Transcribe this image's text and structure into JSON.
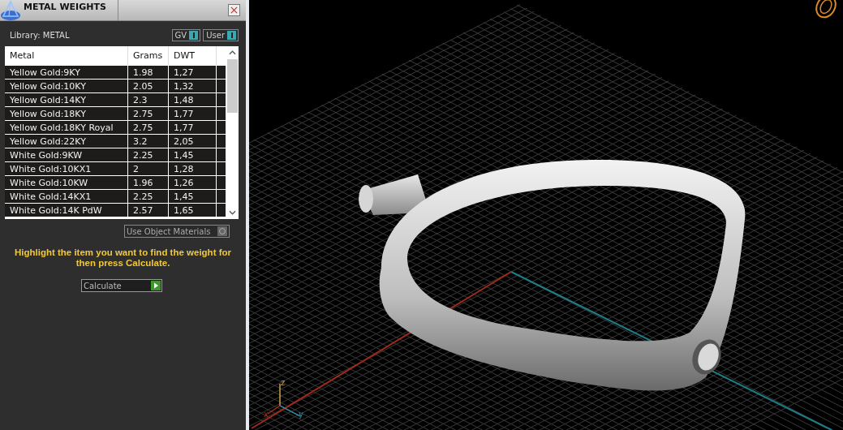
{
  "panel": {
    "title": "METAL WEIGHTS",
    "library_label": "Library: METAL",
    "toggles": [
      {
        "label": "GV",
        "on": true
      },
      {
        "label": "User",
        "on": true
      }
    ],
    "table": {
      "columns": [
        "Metal",
        "Grams",
        "DWT"
      ],
      "rows": [
        {
          "metal": "Yellow Gold:9KY",
          "grams": "1.98",
          "dwt": "1,27"
        },
        {
          "metal": "Yellow Gold:10KY",
          "grams": "2.05",
          "dwt": "1,32"
        },
        {
          "metal": "Yellow Gold:14KY",
          "grams": "2.3",
          "dwt": "1,48"
        },
        {
          "metal": "Yellow Gold:18KY",
          "grams": "2.75",
          "dwt": "1,77"
        },
        {
          "metal": "Yellow Gold:18KY Royal",
          "grams": "2.75",
          "dwt": "1,77"
        },
        {
          "metal": "Yellow Gold:22KY",
          "grams": "3.2",
          "dwt": "2,05"
        },
        {
          "metal": "White Gold:9KW",
          "grams": "2.25",
          "dwt": "1,45"
        },
        {
          "metal": "White Gold:10KX1",
          "grams": "2",
          "dwt": "1,28"
        },
        {
          "metal": "White Gold:10KW",
          "grams": "1.96",
          "dwt": "1,26"
        },
        {
          "metal": "White Gold:14KX1",
          "grams": "2.25",
          "dwt": "1,45"
        },
        {
          "metal": "White Gold:14K PdW",
          "grams": "2.57",
          "dwt": "1,65"
        }
      ]
    },
    "use_object_materials": {
      "label": "Use Object Materials",
      "checked": false
    },
    "instruction": "Highlight the item you want to find the weight for then press Calculate.",
    "calculate_button": "Calculate"
  },
  "viewport": {
    "axis_labels": [
      "z",
      "x",
      "y"
    ]
  }
}
